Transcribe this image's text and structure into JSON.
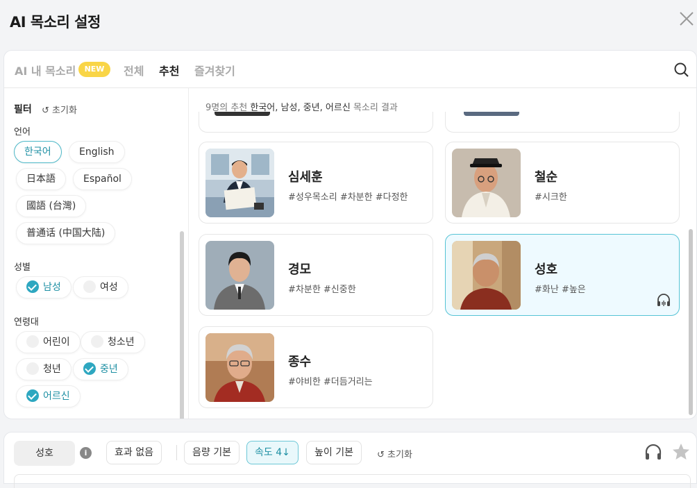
{
  "title": "AI 목소리 설정",
  "tabs": {
    "my_voice": "AI 내 목소리",
    "new_badge": "NEW",
    "all": "전체",
    "recommended": "추천",
    "favorites": "즐겨찾기"
  },
  "filter": {
    "title": "필터",
    "reset": "초기화",
    "language_label": "언어",
    "languages": [
      "한국어",
      "English",
      "日本語",
      "Español",
      "國語 (台灣)",
      "普通话 (中国大陆)"
    ],
    "selected_language": "한국어",
    "gender_label": "성별",
    "genders": [
      "남성",
      "여성"
    ],
    "selected_gender": "남성",
    "age_label": "연령대",
    "ages": [
      "어린이",
      "청소년",
      "청년",
      "중년",
      "어르신"
    ],
    "selected_ages": [
      "중년",
      "어르신"
    ]
  },
  "summary": {
    "prefix": "9명의 추천",
    "filters": "한국어, 남성, 중년, 어르신",
    "suffix": "목소리 결과"
  },
  "voices": [
    {
      "name": "심세훈",
      "tags": "#성우목소리 #차분한 #다정한"
    },
    {
      "name": "철순",
      "tags": "#시크한"
    },
    {
      "name": "경모",
      "tags": "#차분한 #신중한"
    },
    {
      "name": "성호",
      "tags": "#화난 #높은",
      "selected": true
    },
    {
      "name": "종수",
      "tags": "#야비한 #더듬거리는"
    }
  ],
  "bottom": {
    "selected_voice": "성호",
    "effect": "효과 없음",
    "volume": "음량 기본",
    "speed": "속도 4↓",
    "pitch": "높이 기본",
    "reset": "초기화"
  },
  "colors": {
    "accent": "#2ea7c0",
    "badge": "#f9d547",
    "selected_card_bg": "#eefaff"
  }
}
